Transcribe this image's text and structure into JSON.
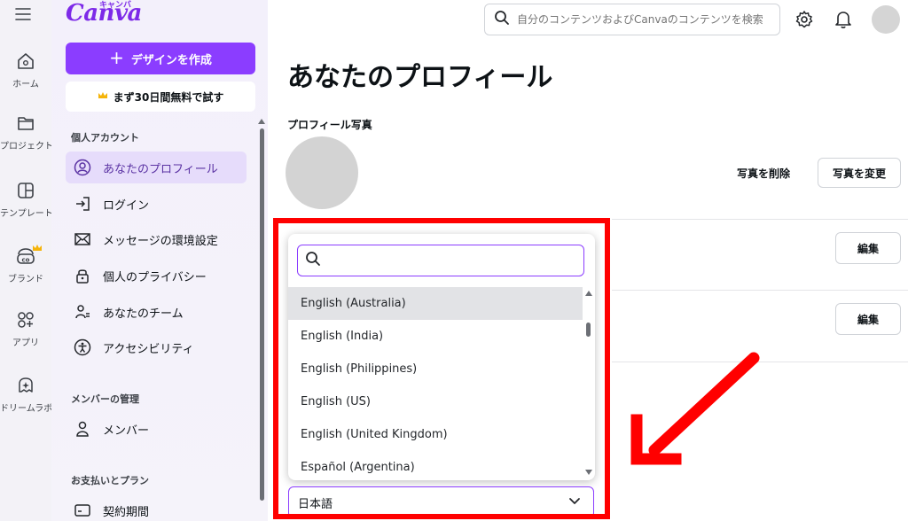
{
  "rail": {
    "items": [
      {
        "label": "ホーム",
        "icon": "home-icon"
      },
      {
        "label": "プロジェクト",
        "icon": "folder-icon"
      },
      {
        "label": "テンプレート",
        "icon": "template-icon"
      },
      {
        "label": "ブランド",
        "icon": "brand-icon"
      },
      {
        "label": "アプリ",
        "icon": "apps-icon"
      },
      {
        "label": "ドリームラボ",
        "icon": "dream-lab-icon"
      }
    ]
  },
  "sidebar": {
    "logo": "Canva",
    "logo_kana": "キャンバ",
    "create_label": "デザインを作成",
    "trial_label": "まず30日間無料で試す",
    "sections": {
      "personal": "個人アカウント",
      "members": "メンバーの管理",
      "billing": "お支払いとプラン"
    },
    "items": [
      {
        "label": "あなたのプロフィール",
        "icon": "profile-icon"
      },
      {
        "label": "ログイン",
        "icon": "login-icon"
      },
      {
        "label": "メッセージの環境設定",
        "icon": "mail-icon"
      },
      {
        "label": "個人のプライバシー",
        "icon": "lock-icon"
      },
      {
        "label": "あなたのチーム",
        "icon": "team-icon"
      },
      {
        "label": "アクセシビリティ",
        "icon": "accessibility-icon"
      },
      {
        "label": "メンバー",
        "icon": "member-icon"
      },
      {
        "label": "契約期間",
        "icon": "card-icon"
      }
    ]
  },
  "header": {
    "search_placeholder": "自分のコンテンツおよびCanvaのコンテンツを検索"
  },
  "main": {
    "title": "あなたのプロフィール",
    "photo_label": "プロフィール写真",
    "delete_photo": "写真を削除",
    "change_photo": "写真を変更",
    "edit_label": "編集"
  },
  "language_dropdown": {
    "search_value": "",
    "options": [
      "English (Australia)",
      "English (India)",
      "English (Philippines)",
      "English (US)",
      "English (United Kingdom)",
      "Español (Argentina)"
    ],
    "hovered_index": 0,
    "selected": "日本語"
  },
  "colors": {
    "accent": "#8b3dff",
    "annotation": "#ff0000"
  }
}
